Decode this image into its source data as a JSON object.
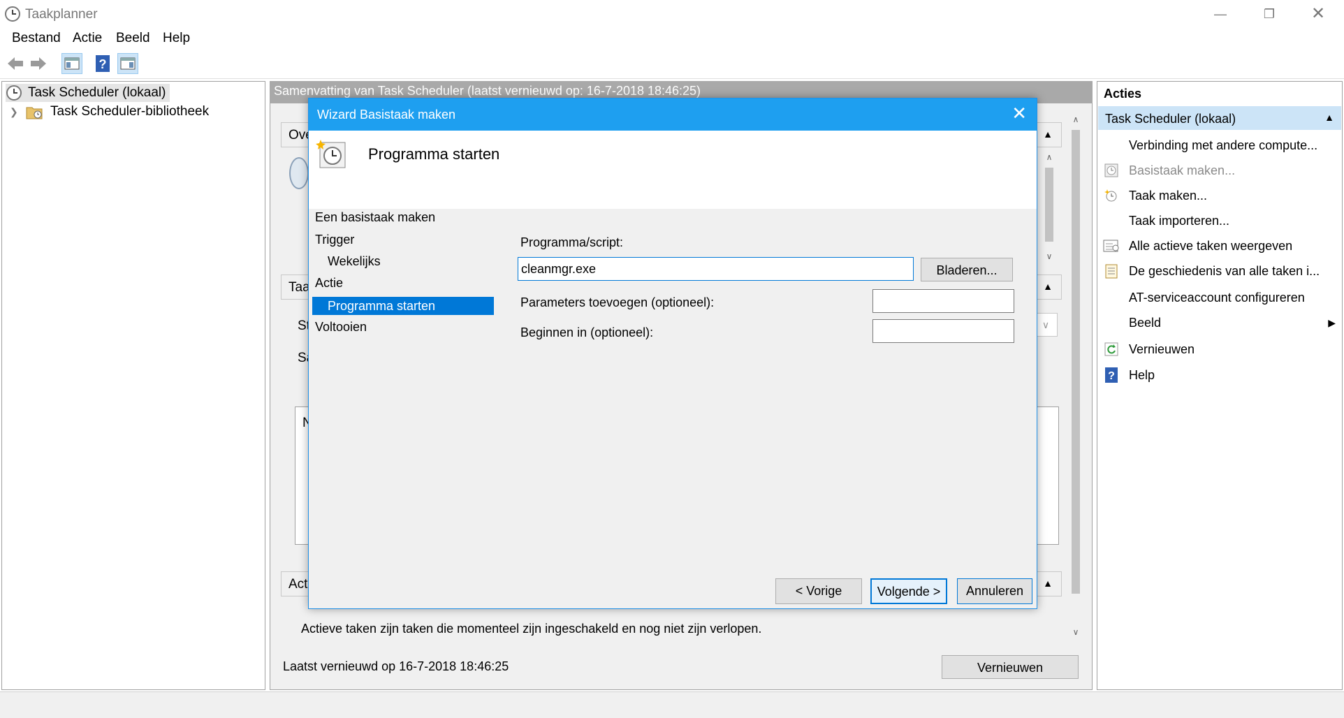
{
  "window": {
    "title": "Taakplanner"
  },
  "menu": [
    "Bestand",
    "Actie",
    "Beeld",
    "Help"
  ],
  "tree": {
    "root": "Task Scheduler (lokaal)",
    "child": "Task Scheduler-bibliotheek"
  },
  "center": {
    "summary_title": "Samenvatting van Task Scheduler (laatst vernieuwd op: 16-7-2018 18:46:25)",
    "section1_label": "Ove",
    "section2_label": "Taa",
    "section2_row1": "St",
    "section2_row2": "Sa",
    "section2_list_stub": "N",
    "section3_label": "Act",
    "active_tasks_desc": "Actieve taken zijn taken die momenteel zijn ingeschakeld en nog niet zijn verlopen.",
    "last_refreshed": "Laatst vernieuwd op 16-7-2018 18:46:25",
    "refresh_button": "Vernieuwen"
  },
  "actions": {
    "header": "Acties",
    "group": "Task Scheduler (lokaal)",
    "items": [
      {
        "label": "Verbinding met andere compute...",
        "icon": "none",
        "disabled": false
      },
      {
        "label": "Basistaak maken...",
        "icon": "basic-task-icon",
        "disabled": true
      },
      {
        "label": "Taak maken...",
        "icon": "create-task-icon",
        "disabled": false
      },
      {
        "label": "Taak importeren...",
        "icon": "none",
        "disabled": false
      },
      {
        "label": "Alle actieve taken weergeven",
        "icon": "active-tasks-icon",
        "disabled": false
      },
      {
        "label": "De geschiedenis van alle taken i...",
        "icon": "history-icon",
        "disabled": false
      },
      {
        "label": "AT-serviceaccount configureren",
        "icon": "none",
        "disabled": false
      },
      {
        "label": "Beeld",
        "icon": "none",
        "disabled": false
      },
      {
        "label": "Vernieuwen",
        "icon": "refresh-icon",
        "disabled": false
      },
      {
        "label": "Help",
        "icon": "help-icon",
        "disabled": false
      }
    ]
  },
  "dialog": {
    "title": "Wizard Basistaak maken",
    "heading": "Programma starten",
    "steps": [
      "Een basistaak maken",
      "Trigger",
      "Wekelijks",
      "Actie",
      "Programma starten",
      "Voltooien"
    ],
    "program_label": "Programma/script:",
    "program_value": "cleanmgr.exe",
    "browse_button": "Bladeren...",
    "params_label": "Parameters toevoegen (optioneel):",
    "params_value": "",
    "start_in_label": "Beginnen in (optioneel):",
    "start_in_value": "",
    "back_button": "< Vorige",
    "next_button": "Volgende >",
    "cancel_button": "Annuleren"
  },
  "colors": {
    "accent": "#1e9ff0",
    "selection": "#0078d7",
    "group_bg": "#cce4f7"
  }
}
